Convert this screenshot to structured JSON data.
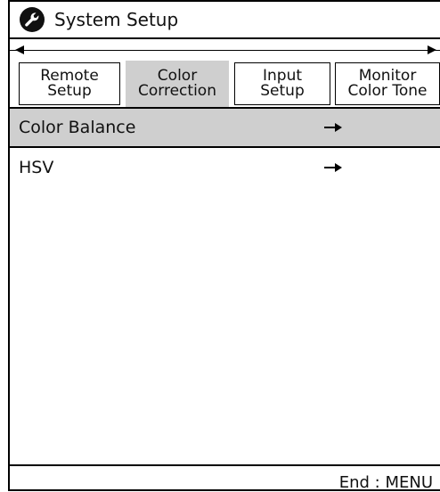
{
  "window": {
    "title": "System Setup",
    "icon": "wrench-icon"
  },
  "tabs": {
    "scroll_left_icon": "scroll-left-icon",
    "scroll_right_icon": "scroll-right-icon",
    "items": [
      {
        "line1": "Remote",
        "line2": "Setup",
        "selected": false
      },
      {
        "line1": "Color",
        "line2": "Correction",
        "selected": true
      },
      {
        "line1": "Input",
        "line2": "Setup",
        "selected": false
      },
      {
        "line1": "Monitor",
        "line2": "Color Tone",
        "selected": false
      }
    ]
  },
  "menu": {
    "items": [
      {
        "label": "Color Balance",
        "selected": true,
        "arrow_icon": "arrow-right-icon"
      },
      {
        "label": "HSV",
        "selected": false,
        "arrow_icon": "arrow-right-icon"
      }
    ]
  },
  "footer": {
    "status_text": "End : MENU"
  },
  "colors": {
    "selected_bg": "#cfcfcf",
    "border": "#000000",
    "background": "#ffffff"
  }
}
